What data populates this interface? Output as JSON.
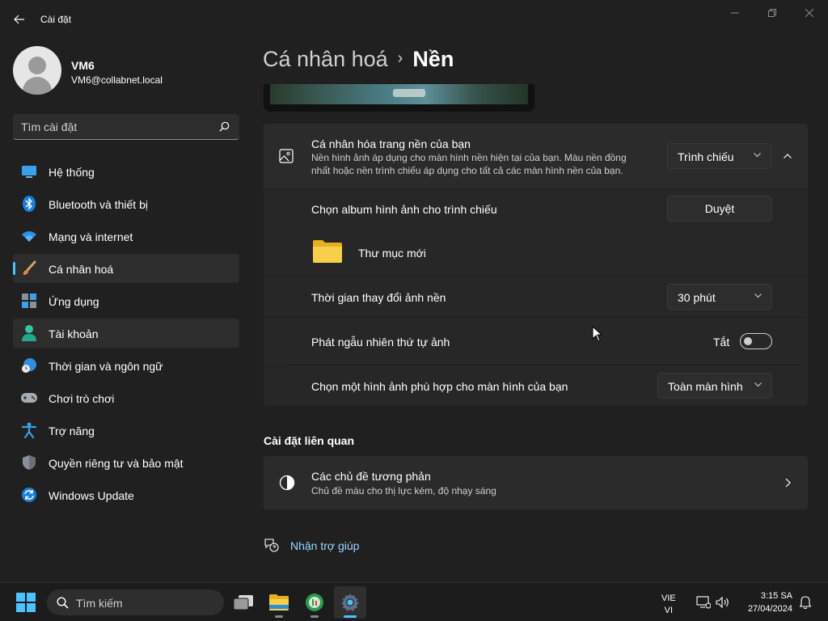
{
  "window": {
    "title": "Cài đặt"
  },
  "profile": {
    "name": "VM6",
    "email": "VM6@collabnet.local"
  },
  "search": {
    "placeholder": "Tìm cài đặt"
  },
  "nav": {
    "items": [
      {
        "label": "Hệ thống",
        "icon": "system-icon"
      },
      {
        "label": "Bluetooth và thiết bị",
        "icon": "bluetooth-icon"
      },
      {
        "label": "Mạng và internet",
        "icon": "wifi-icon"
      },
      {
        "label": "Cá nhân hoá",
        "icon": "brush-icon"
      },
      {
        "label": "Ứng dụng",
        "icon": "apps-icon"
      },
      {
        "label": "Tài khoản",
        "icon": "account-icon"
      },
      {
        "label": "Thời gian và ngôn ngữ",
        "icon": "time-language-icon"
      },
      {
        "label": "Chơi trò chơi",
        "icon": "gamepad-icon"
      },
      {
        "label": "Trợ năng",
        "icon": "accessibility-icon"
      },
      {
        "label": "Quyền riêng tư và bảo mật",
        "icon": "shield-icon"
      },
      {
        "label": "Windows Update",
        "icon": "update-icon"
      }
    ],
    "active_index": 3
  },
  "breadcrumb": {
    "parent": "Cá nhân hoá",
    "separator": "›",
    "current": "Nền"
  },
  "background": {
    "title": "Cá nhân hóa trang nền của bạn",
    "description": "Nền hình ảnh áp dụng cho màn hình nền hiện tại của bạn. Màu nền đồng nhất hoặc nền trình chiếu áp dụng cho tất cả các màn hình nền của bạn.",
    "type_value": "Trình chiếu",
    "album_label": "Chọn album hình ảnh cho trình chiếu",
    "browse_label": "Duyệt",
    "folder_name": "Thư mục mới",
    "interval_label": "Thời gian thay đổi ảnh nền",
    "interval_value": "30 phút",
    "shuffle_label": "Phát ngẫu nhiên thứ tự ảnh",
    "shuffle_state": "Tắt",
    "fit_label": "Chọn một hình ảnh phù hợp cho màn hình của bạn",
    "fit_value": "Toàn màn hình"
  },
  "related": {
    "section_title": "Cài đặt liên quan",
    "contrast_title": "Các chủ đề tương phản",
    "contrast_desc": "Chủ đề màu cho thị lực kém, độ nhạy sáng"
  },
  "help": {
    "label": "Nhận trợ giúp"
  },
  "taskbar": {
    "search_label": "Tìm kiếm",
    "lang_line1": "VIE",
    "lang_line2": "VI",
    "time": "3:15 SA",
    "date": "27/04/2024"
  },
  "colors": {
    "accent": "#4cc2ff",
    "background": "#202020",
    "card": "#2b2b2b"
  }
}
